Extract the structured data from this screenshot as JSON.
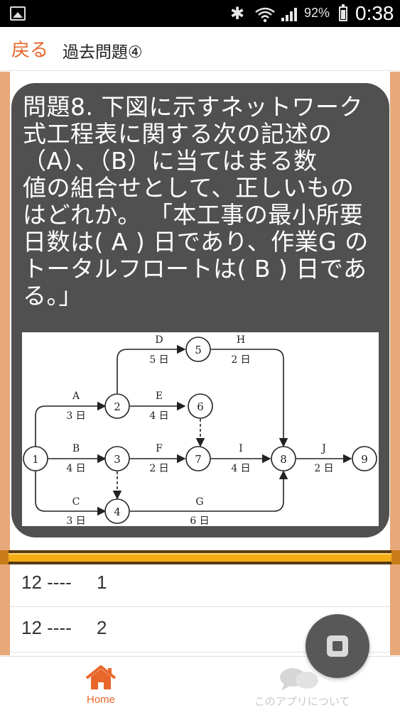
{
  "status_bar": {
    "battery_percent": "92%",
    "time": "0:38",
    "bluetooth_icon": "bluetooth-icon",
    "wifi_icon": "wifi-icon",
    "signal_icon": "signal-icon"
  },
  "header": {
    "back_label": "戻る",
    "title": "過去問題④"
  },
  "question": {
    "lines": [
      "問題8. 下図に示すネットワーク",
      "式工程表に関する次の記述の",
      "（A）、（B）に当てはまる数",
      "値の組合せとして、正しいもの",
      "はどれか。 「本工事の最小所要",
      "日数は( A ) 日であり、作業G の",
      "トータルフロートは( B ) 日であ",
      "る。」"
    ]
  },
  "diagram": {
    "nodes": [
      "1",
      "2",
      "3",
      "4",
      "5",
      "6",
      "7",
      "8",
      "9"
    ],
    "activities": [
      {
        "name": "A",
        "duration": "3 日"
      },
      {
        "name": "B",
        "duration": "4 日"
      },
      {
        "name": "C",
        "duration": "3 日"
      },
      {
        "name": "D",
        "duration": "5 日"
      },
      {
        "name": "E",
        "duration": "4 日"
      },
      {
        "name": "F",
        "duration": "2 日"
      },
      {
        "name": "G",
        "duration": "6 日"
      },
      {
        "name": "H",
        "duration": "2 日"
      },
      {
        "name": "I",
        "duration": "4 日"
      },
      {
        "name": "J",
        "duration": "2 日"
      }
    ]
  },
  "answers": [
    {
      "a": "12 ----",
      "b": "1"
    },
    {
      "a": "12 ----",
      "b": "2"
    }
  ],
  "bottom_nav": {
    "home_label": "Home",
    "about_label": "このアプリについて"
  },
  "colors": {
    "accent": "#e8662a",
    "card": "#505050",
    "bar": "#f6ac15",
    "frame": "#e9b98c"
  }
}
